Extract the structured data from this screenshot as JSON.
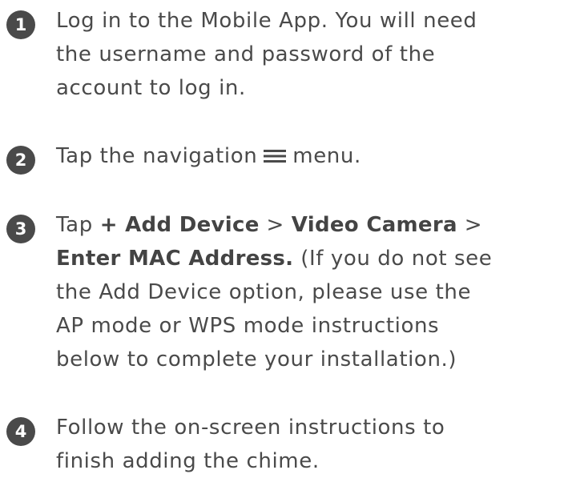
{
  "steps": [
    {
      "number": "1",
      "lines": [
        "Log in to the Mobile App. You will need",
        "the username and password of the",
        "account to log in."
      ]
    },
    {
      "number": "2",
      "before": "Tap the navigation",
      "icon": "hamburger-menu-icon",
      "after": "menu."
    },
    {
      "number": "3",
      "line1": {
        "t1": "Tap ",
        "b1": "+ Add Device",
        "t2": " > ",
        "b2": "Video Camera",
        "t3": " >"
      },
      "line2": {
        "b1": "Enter MAC Address.",
        "t1": " (If you do not see"
      },
      "lines": [
        "the Add Device option, please use the",
        "AP mode or WPS mode instructions",
        "below to complete your installation.)"
      ]
    },
    {
      "number": "4",
      "lines": [
        "Follow the on-screen instructions to",
        "finish adding the chime."
      ]
    }
  ],
  "colors": {
    "text": "#4a4a4a",
    "badge": "#4a4a4a",
    "badge_text": "#ffffff"
  }
}
